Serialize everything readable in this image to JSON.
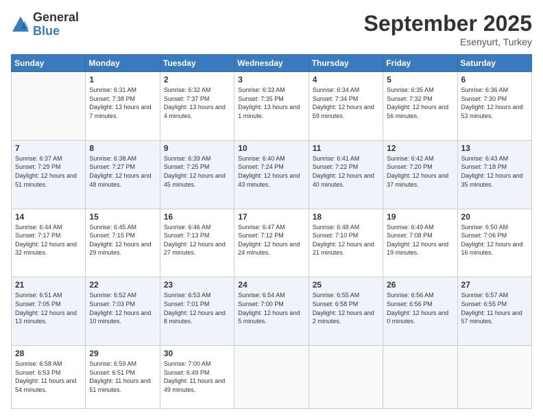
{
  "logo": {
    "general": "General",
    "blue": "Blue"
  },
  "header": {
    "month": "September 2025",
    "location": "Esenyurt, Turkey"
  },
  "weekdays": [
    "Sunday",
    "Monday",
    "Tuesday",
    "Wednesday",
    "Thursday",
    "Friday",
    "Saturday"
  ],
  "weeks": [
    [
      {
        "day": "",
        "sunrise": "",
        "sunset": "",
        "daylight": ""
      },
      {
        "day": "1",
        "sunrise": "Sunrise: 6:31 AM",
        "sunset": "Sunset: 7:38 PM",
        "daylight": "Daylight: 13 hours and 7 minutes."
      },
      {
        "day": "2",
        "sunrise": "Sunrise: 6:32 AM",
        "sunset": "Sunset: 7:37 PM",
        "daylight": "Daylight: 13 hours and 4 minutes."
      },
      {
        "day": "3",
        "sunrise": "Sunrise: 6:33 AM",
        "sunset": "Sunset: 7:35 PM",
        "daylight": "Daylight: 13 hours and 1 minute."
      },
      {
        "day": "4",
        "sunrise": "Sunrise: 6:34 AM",
        "sunset": "Sunset: 7:34 PM",
        "daylight": "Daylight: 12 hours and 59 minutes."
      },
      {
        "day": "5",
        "sunrise": "Sunrise: 6:35 AM",
        "sunset": "Sunset: 7:32 PM",
        "daylight": "Daylight: 12 hours and 56 minutes."
      },
      {
        "day": "6",
        "sunrise": "Sunrise: 6:36 AM",
        "sunset": "Sunset: 7:30 PM",
        "daylight": "Daylight: 12 hours and 53 minutes."
      }
    ],
    [
      {
        "day": "7",
        "sunrise": "Sunrise: 6:37 AM",
        "sunset": "Sunset: 7:29 PM",
        "daylight": "Daylight: 12 hours and 51 minutes."
      },
      {
        "day": "8",
        "sunrise": "Sunrise: 6:38 AM",
        "sunset": "Sunset: 7:27 PM",
        "daylight": "Daylight: 12 hours and 48 minutes."
      },
      {
        "day": "9",
        "sunrise": "Sunrise: 6:39 AM",
        "sunset": "Sunset: 7:25 PM",
        "daylight": "Daylight: 12 hours and 45 minutes."
      },
      {
        "day": "10",
        "sunrise": "Sunrise: 6:40 AM",
        "sunset": "Sunset: 7:24 PM",
        "daylight": "Daylight: 12 hours and 43 minutes."
      },
      {
        "day": "11",
        "sunrise": "Sunrise: 6:41 AM",
        "sunset": "Sunset: 7:22 PM",
        "daylight": "Daylight: 12 hours and 40 minutes."
      },
      {
        "day": "12",
        "sunrise": "Sunrise: 6:42 AM",
        "sunset": "Sunset: 7:20 PM",
        "daylight": "Daylight: 12 hours and 37 minutes."
      },
      {
        "day": "13",
        "sunrise": "Sunrise: 6:43 AM",
        "sunset": "Sunset: 7:18 PM",
        "daylight": "Daylight: 12 hours and 35 minutes."
      }
    ],
    [
      {
        "day": "14",
        "sunrise": "Sunrise: 6:44 AM",
        "sunset": "Sunset: 7:17 PM",
        "daylight": "Daylight: 12 hours and 32 minutes."
      },
      {
        "day": "15",
        "sunrise": "Sunrise: 6:45 AM",
        "sunset": "Sunset: 7:15 PM",
        "daylight": "Daylight: 12 hours and 29 minutes."
      },
      {
        "day": "16",
        "sunrise": "Sunrise: 6:46 AM",
        "sunset": "Sunset: 7:13 PM",
        "daylight": "Daylight: 12 hours and 27 minutes."
      },
      {
        "day": "17",
        "sunrise": "Sunrise: 6:47 AM",
        "sunset": "Sunset: 7:12 PM",
        "daylight": "Daylight: 12 hours and 24 minutes."
      },
      {
        "day": "18",
        "sunrise": "Sunrise: 6:48 AM",
        "sunset": "Sunset: 7:10 PM",
        "daylight": "Daylight: 12 hours and 21 minutes."
      },
      {
        "day": "19",
        "sunrise": "Sunrise: 6:49 AM",
        "sunset": "Sunset: 7:08 PM",
        "daylight": "Daylight: 12 hours and 19 minutes."
      },
      {
        "day": "20",
        "sunrise": "Sunrise: 6:50 AM",
        "sunset": "Sunset: 7:06 PM",
        "daylight": "Daylight: 12 hours and 16 minutes."
      }
    ],
    [
      {
        "day": "21",
        "sunrise": "Sunrise: 6:51 AM",
        "sunset": "Sunset: 7:05 PM",
        "daylight": "Daylight: 12 hours and 13 minutes."
      },
      {
        "day": "22",
        "sunrise": "Sunrise: 6:52 AM",
        "sunset": "Sunset: 7:03 PM",
        "daylight": "Daylight: 12 hours and 10 minutes."
      },
      {
        "day": "23",
        "sunrise": "Sunrise: 6:53 AM",
        "sunset": "Sunset: 7:01 PM",
        "daylight": "Daylight: 12 hours and 8 minutes."
      },
      {
        "day": "24",
        "sunrise": "Sunrise: 6:54 AM",
        "sunset": "Sunset: 7:00 PM",
        "daylight": "Daylight: 12 hours and 5 minutes."
      },
      {
        "day": "25",
        "sunrise": "Sunrise: 6:55 AM",
        "sunset": "Sunset: 6:58 PM",
        "daylight": "Daylight: 12 hours and 2 minutes."
      },
      {
        "day": "26",
        "sunrise": "Sunrise: 6:56 AM",
        "sunset": "Sunset: 6:56 PM",
        "daylight": "Daylight: 12 hours and 0 minutes."
      },
      {
        "day": "27",
        "sunrise": "Sunrise: 6:57 AM",
        "sunset": "Sunset: 6:55 PM",
        "daylight": "Daylight: 11 hours and 57 minutes."
      }
    ],
    [
      {
        "day": "28",
        "sunrise": "Sunrise: 6:58 AM",
        "sunset": "Sunset: 6:53 PM",
        "daylight": "Daylight: 11 hours and 54 minutes."
      },
      {
        "day": "29",
        "sunrise": "Sunrise: 6:59 AM",
        "sunset": "Sunset: 6:51 PM",
        "daylight": "Daylight: 11 hours and 51 minutes."
      },
      {
        "day": "30",
        "sunrise": "Sunrise: 7:00 AM",
        "sunset": "Sunset: 6:49 PM",
        "daylight": "Daylight: 11 hours and 49 minutes."
      },
      {
        "day": "",
        "sunrise": "",
        "sunset": "",
        "daylight": ""
      },
      {
        "day": "",
        "sunrise": "",
        "sunset": "",
        "daylight": ""
      },
      {
        "day": "",
        "sunrise": "",
        "sunset": "",
        "daylight": ""
      },
      {
        "day": "",
        "sunrise": "",
        "sunset": "",
        "daylight": ""
      }
    ]
  ]
}
